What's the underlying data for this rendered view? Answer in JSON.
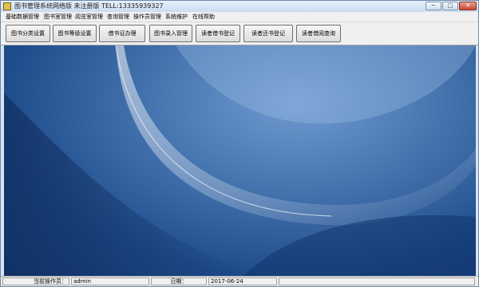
{
  "window": {
    "title": "图书管理系统网络版 未注册版 TELL:13335939327",
    "controls": {
      "minimize": "─",
      "maximize": "□",
      "close": "✕"
    }
  },
  "menu": {
    "items": [
      {
        "label": "基础数据管理"
      },
      {
        "label": "图书室管理"
      },
      {
        "label": "阅览室管理"
      },
      {
        "label": "查询管理"
      },
      {
        "label": "操作员管理"
      },
      {
        "label": "系统维护"
      },
      {
        "label": "在线帮助"
      }
    ]
  },
  "toolbar": {
    "buttons": [
      {
        "label": "图书分类设置"
      },
      {
        "label": "图书等级设置"
      },
      {
        "label": "借书证办理"
      },
      {
        "label": "图书录入管理"
      },
      {
        "label": "读者借书登记"
      },
      {
        "label": "读者还书登记"
      },
      {
        "label": "读者借阅查询"
      }
    ]
  },
  "status": {
    "operator_label": "当前操作员：",
    "operator_value": "admin",
    "date_label": "日期：",
    "date_value": "2017-06-24"
  },
  "colors": {
    "title_gradient": [
      "#e8f1fb",
      "#c9dcef"
    ],
    "desktop_base": "#1d4b8b",
    "desktop_highlight": "#6f9bd0"
  }
}
